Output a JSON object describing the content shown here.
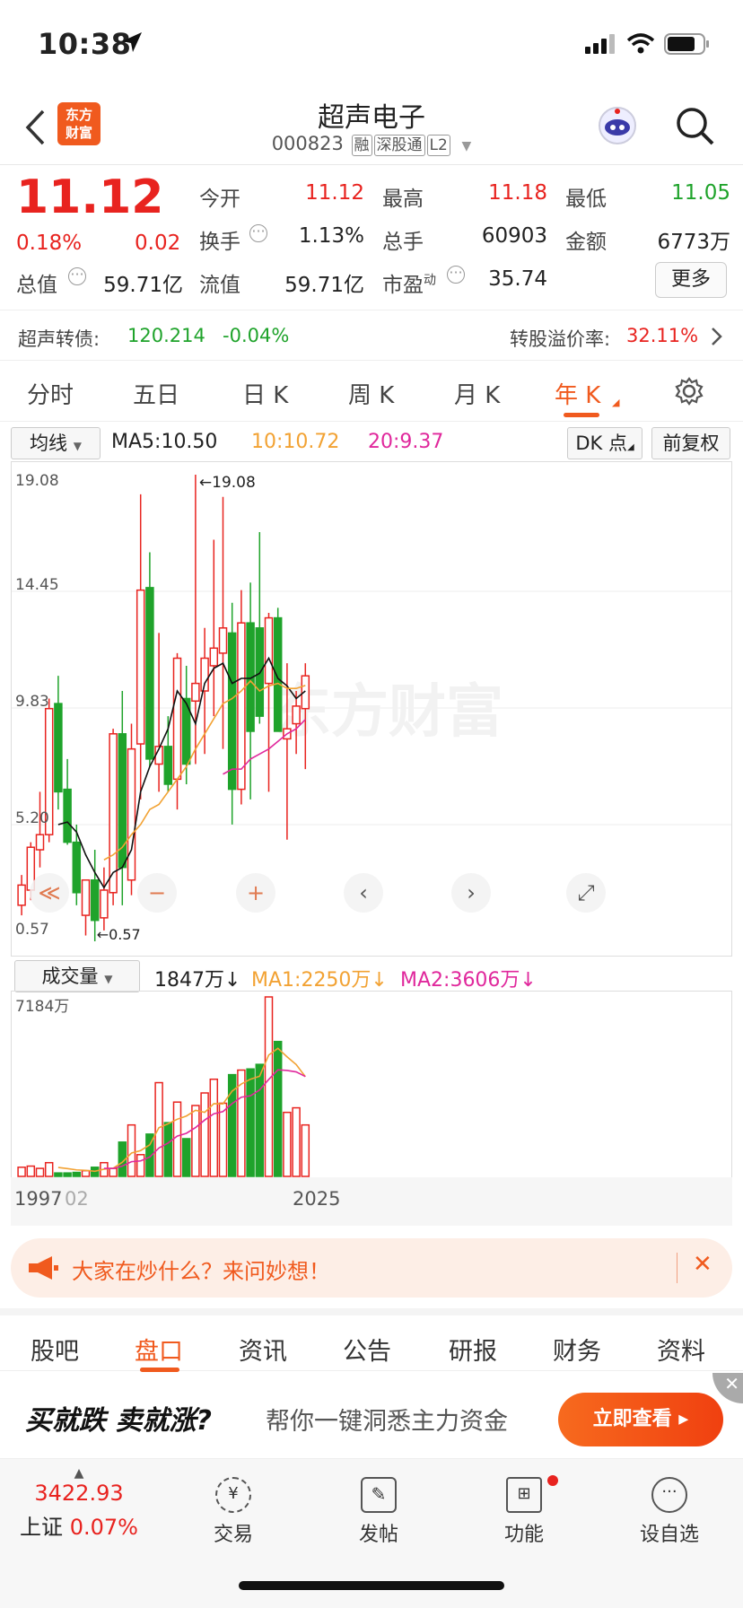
{
  "status_bar": {
    "time": "10:38"
  },
  "header": {
    "logo_text": "东方财富",
    "stock_name": "超声电子",
    "stock_code": "000823",
    "tags": [
      "融",
      "深股通",
      "L2"
    ]
  },
  "quote": {
    "price": "11.12",
    "change_pct": "0.18%",
    "change_amt": "0.02",
    "open_label": "今开",
    "open": "11.12",
    "high_label": "最高",
    "high": "11.18",
    "low_label": "最低",
    "low": "11.05",
    "turnover_label": "换手",
    "turnover": "1.13%",
    "volume_label": "总手",
    "volume": "60903",
    "amount_label": "金额",
    "amount": "6773万",
    "mktcap_label": "总值",
    "mktcap": "59.71亿",
    "float_label": "流值",
    "float": "59.71亿",
    "pe_label": "市盈",
    "pe_sup": "动",
    "pe": "35.74",
    "more": "更多",
    "colors": {
      "up": "#e8231f",
      "down": "#1fa32b"
    }
  },
  "bond": {
    "label": "超声转债:",
    "price": "120.214",
    "change": "-0.04%",
    "premium_label": "转股溢价率:",
    "premium": "32.11%"
  },
  "periods": {
    "tabs": [
      "分时",
      "五日",
      "日 K",
      "周 K",
      "月 K",
      "年 K"
    ],
    "active": "年 K"
  },
  "ma_row": {
    "dropdown": "均线",
    "ma5": "MA5:10.50",
    "ma10": "10:10.72",
    "ma20": "20:9.37",
    "dk": "DK 点",
    "fq": "前复权"
  },
  "chart_labels": {
    "y_ticks": [
      "19.08",
      "14.45",
      "9.83",
      "5.20",
      "0.57"
    ],
    "max_mark": "←19.08",
    "min_mark": "←0.57",
    "watermark": "东方财富"
  },
  "chart_data": {
    "type": "candlestick",
    "ylim": [
      0.57,
      19.08
    ],
    "candles": [
      {
        "o": 2.0,
        "h": 3.2,
        "l": 1.6,
        "c": 2.8
      },
      {
        "o": 2.6,
        "h": 4.5,
        "l": 2.2,
        "c": 4.3
      },
      {
        "o": 4.2,
        "h": 6.5,
        "l": 3.5,
        "c": 4.8
      },
      {
        "o": 4.8,
        "h": 10.2,
        "l": 4.5,
        "c": 9.8
      },
      {
        "o": 10.0,
        "h": 11.1,
        "l": 5.8,
        "c": 6.5
      },
      {
        "o": 6.6,
        "h": 7.8,
        "l": 4.4,
        "c": 4.5
      },
      {
        "o": 4.5,
        "h": 5.2,
        "l": 2.0,
        "c": 2.5
      },
      {
        "o": 1.6,
        "h": 3.0,
        "l": 0.8,
        "c": 3.0
      },
      {
        "o": 3.0,
        "h": 4.2,
        "l": 0.57,
        "c": 1.4
      },
      {
        "o": 1.5,
        "h": 3.5,
        "l": 1.0,
        "c": 2.6
      },
      {
        "o": 2.5,
        "h": 9.0,
        "l": 2.0,
        "c": 8.8
      },
      {
        "o": 8.8,
        "h": 10.5,
        "l": 2.0,
        "c": 3.5
      },
      {
        "o": 3.0,
        "h": 9.2,
        "l": 2.4,
        "c": 8.2
      },
      {
        "o": 8.4,
        "h": 18.3,
        "l": 6.2,
        "c": 14.5
      },
      {
        "o": 14.6,
        "h": 16.0,
        "l": 7.5,
        "c": 7.8
      },
      {
        "o": 7.6,
        "h": 12.8,
        "l": 6.5,
        "c": 8.3
      },
      {
        "o": 8.3,
        "h": 9.5,
        "l": 6.5,
        "c": 6.8
      },
      {
        "o": 7.0,
        "h": 12.0,
        "l": 5.8,
        "c": 11.8
      },
      {
        "o": 10.2,
        "h": 11.5,
        "l": 6.8,
        "c": 7.6
      },
      {
        "o": 10.1,
        "h": 19.08,
        "l": 7.6,
        "c": 10.8
      },
      {
        "o": 10.5,
        "h": 13.0,
        "l": 8.0,
        "c": 11.8
      },
      {
        "o": 11.5,
        "h": 16.5,
        "l": 9.5,
        "c": 12.2
      },
      {
        "o": 12.0,
        "h": 18.2,
        "l": 8.2,
        "c": 13.0
      },
      {
        "o": 12.8,
        "h": 14.0,
        "l": 5.2,
        "c": 6.6
      },
      {
        "o": 6.6,
        "h": 14.5,
        "l": 6.0,
        "c": 13.2
      },
      {
        "o": 13.2,
        "h": 14.8,
        "l": 6.2,
        "c": 8.9
      },
      {
        "o": 13.0,
        "h": 16.8,
        "l": 9.2,
        "c": 9.5
      },
      {
        "o": 10.8,
        "h": 13.6,
        "l": 6.5,
        "c": 13.4
      },
      {
        "o": 13.4,
        "h": 13.8,
        "l": 9.2,
        "c": 8.9
      },
      {
        "o": 8.6,
        "h": 11.6,
        "l": 4.6,
        "c": 9.0
      },
      {
        "o": 9.2,
        "h": 10.5,
        "l": 8.0,
        "c": 9.9
      },
      {
        "o": 9.8,
        "h": 11.6,
        "l": 7.4,
        "c": 11.1
      }
    ],
    "ma5": [
      null,
      null,
      null,
      null,
      5.2,
      5.3,
      4.9,
      4.0,
      3.3,
      2.7,
      3.3,
      3.5,
      4.2,
      6.5,
      7.5,
      8.2,
      9.0,
      10.5,
      10.0,
      9.2,
      10.8,
      11.4,
      11.6,
      10.8,
      11.0,
      11.0,
      11.2,
      11.8,
      11.0,
      10.7,
      10.2,
      10.5
    ],
    "ma10": [
      null,
      null,
      null,
      null,
      null,
      null,
      null,
      null,
      null,
      3.8,
      4.0,
      4.3,
      4.8,
      5.2,
      5.8,
      6.0,
      6.5,
      7.0,
      7.5,
      8.2,
      8.8,
      9.4,
      10.0,
      10.2,
      10.5,
      10.9,
      10.5,
      10.7,
      10.8,
      10.6,
      10.6,
      10.72
    ],
    "ma20": [
      null,
      null,
      null,
      null,
      null,
      null,
      null,
      null,
      null,
      null,
      null,
      null,
      null,
      null,
      null,
      null,
      null,
      null,
      null,
      null,
      null,
      null,
      7.2,
      7.4,
      7.4,
      7.8,
      8.0,
      8.2,
      8.5,
      8.8,
      9.0,
      9.37
    ],
    "volume": [
      80,
      90,
      70,
      120,
      30,
      30,
      35,
      50,
      80,
      120,
      70,
      300,
      450,
      190,
      370,
      820,
      470,
      650,
      330,
      620,
      730,
      850,
      640,
      890,
      930,
      940,
      980,
      1570,
      1180,
      560,
      600,
      450
    ],
    "vol_ma1": [
      null,
      null,
      null,
      null,
      110,
      null,
      null,
      null,
      null,
      null,
      null,
      null,
      null,
      null,
      null,
      null,
      null,
      null,
      null,
      null,
      null,
      null,
      null,
      null,
      null,
      null,
      null,
      null,
      null,
      null,
      null,
      2250
    ],
    "x_start": "1997",
    "x_end": "2025"
  },
  "chart_controls": [
    "≪",
    "−",
    "+",
    "‹",
    "›",
    "⤢"
  ],
  "volume": {
    "dropdown": "成交量",
    "value": "1847万↓",
    "ma1": "MA1:2250万↓",
    "ma2": "MA2:3606万↓",
    "ymax": "7184万"
  },
  "xaxis": {
    "labels": [
      "1997",
      "02",
      "2025"
    ]
  },
  "banner": {
    "text": "大家在炒什么？来问妙想！",
    "close": "✕"
  },
  "bottom_tabs": {
    "tabs": [
      "股吧",
      "盘口",
      "资讯",
      "公告",
      "研报",
      "财务",
      "资料"
    ],
    "active": "盘口"
  },
  "ad": {
    "slogan": "买就跌 卖就涨?",
    "text": "帮你一键洞悉主力资金",
    "cta": "立即查看 ▸"
  },
  "nav": {
    "index_value": "3422.93",
    "index_name": "上证",
    "index_pct": "0.07%",
    "items": [
      "交易",
      "发帖",
      "功能",
      "设自选"
    ]
  }
}
